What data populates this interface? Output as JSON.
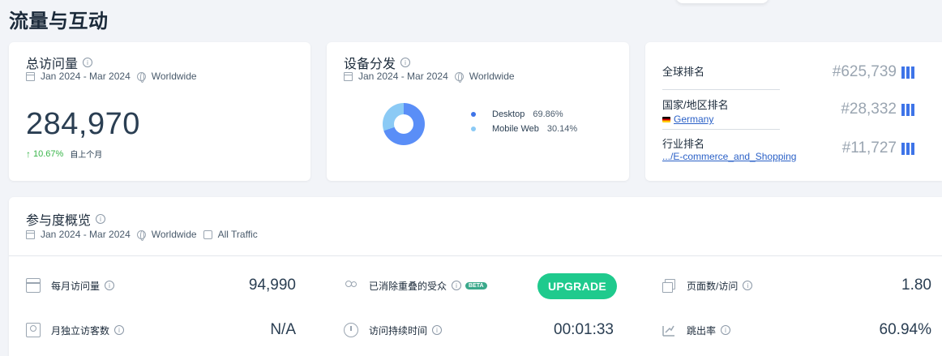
{
  "page": {
    "title": "流量与互动"
  },
  "visits_card": {
    "title": "总访问量",
    "date_range": "Jan 2024 - Mar 2024",
    "region": "Worldwide",
    "value": "284,970",
    "change": "10.67%",
    "change_label": "自上个月"
  },
  "device_card": {
    "title": "设备分发",
    "date_range": "Jan 2024 - Mar 2024",
    "region": "Worldwide",
    "items": [
      {
        "label": "Desktop",
        "pct": "69.86%",
        "color": "#5a8ef7"
      },
      {
        "label": "Mobile Web",
        "pct": "30.14%",
        "color": "#8bcaf5"
      }
    ]
  },
  "rank_card": {
    "global": {
      "label": "全球排名",
      "value": "#625,739"
    },
    "country": {
      "label": "国家/地区排名",
      "link": "Germany",
      "value": "#28,332"
    },
    "industry": {
      "label": "行业排名",
      "link": ".../E-commerce_and_Shopping",
      "value": "#11,727"
    }
  },
  "engagement": {
    "title": "参与度概览",
    "date_range": "Jan 2024 - Mar 2024",
    "region": "Worldwide",
    "traffic": "All Traffic",
    "metrics": {
      "monthly_visits": {
        "label": "每月访问量",
        "value": "94,990"
      },
      "dedup_audience": {
        "label": "已消除重叠的受众",
        "badge": "BETA",
        "button": "UPGRADE"
      },
      "pages_per_visit": {
        "label": "页面数/访问",
        "value": "1.80"
      },
      "unique_visitors": {
        "label": "月独立访客数",
        "value": "N/A"
      },
      "visit_duration": {
        "label": "访问持续时间",
        "value": "00:01:33"
      },
      "bounce_rate": {
        "label": "跳出率",
        "value": "60.94%"
      }
    }
  },
  "colors": {
    "accent": "#3e74e8",
    "upgrade": "#1fca8d",
    "positive": "#39b54a"
  }
}
